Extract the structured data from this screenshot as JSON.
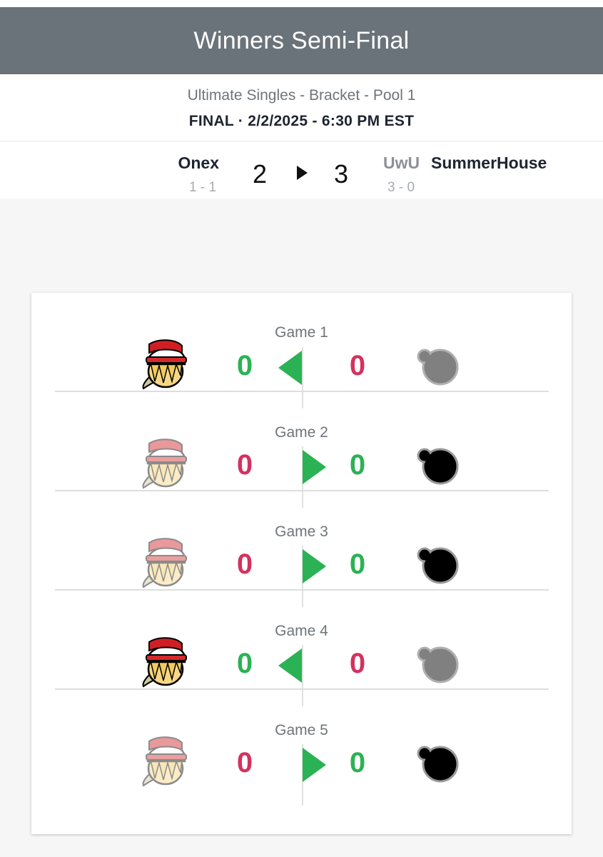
{
  "header": {
    "title": "Winners Semi-Final"
  },
  "match_info": {
    "event": "Ultimate Singles - Bracket - Pool 1",
    "status": "FINAL · 2/2/2025 - 6:30 PM EST"
  },
  "scoreboard": {
    "left": {
      "name": "Onex",
      "record": "1 - 1",
      "score": "2"
    },
    "right": {
      "tag": "UwU",
      "name": "SummerHouse",
      "record": "3 - 0",
      "score": "3"
    },
    "winner": "right"
  },
  "games": [
    {
      "label": "Game 1",
      "left_score": "0",
      "right_score": "0",
      "winner": "left",
      "left_icon": "red-cap-fighter-icon",
      "right_icon": "gray-blob-icon"
    },
    {
      "label": "Game 2",
      "left_score": "0",
      "right_score": "0",
      "winner": "right",
      "left_icon": "red-cap-fighter-icon",
      "right_icon": "black-blob-icon"
    },
    {
      "label": "Game 3",
      "left_score": "0",
      "right_score": "0",
      "winner": "right",
      "left_icon": "red-cap-fighter-icon",
      "right_icon": "black-blob-icon"
    },
    {
      "label": "Game 4",
      "left_score": "0",
      "right_score": "0",
      "winner": "left",
      "left_icon": "red-cap-fighter-icon",
      "right_icon": "gray-blob-icon"
    },
    {
      "label": "Game 5",
      "left_score": "0",
      "right_score": "0",
      "winner": "right",
      "left_icon": "red-cap-fighter-icon",
      "right_icon": "black-blob-icon"
    }
  ],
  "colors": {
    "header_bg": "#6b737a",
    "win": "#2bb254",
    "loss": "#d3325f"
  }
}
